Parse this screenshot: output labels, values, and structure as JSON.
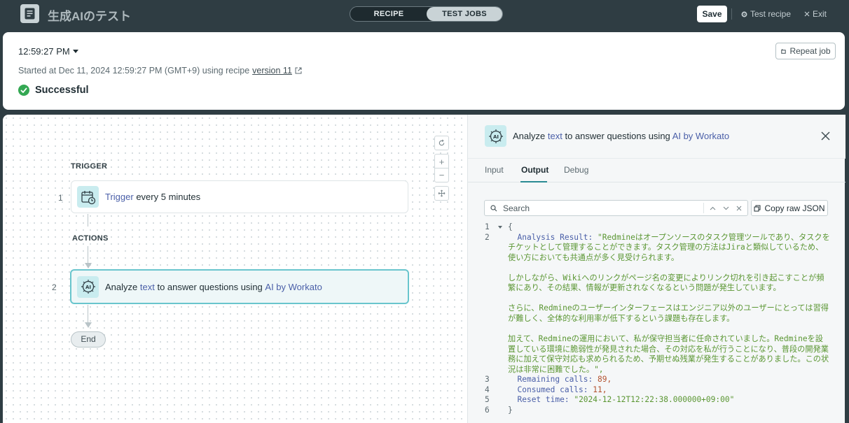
{
  "header": {
    "app_title": "生成AIのテスト",
    "mode_tabs": [
      "RECIPE",
      "TEST JOBS"
    ],
    "active_mode": "TEST JOBS",
    "save_label": "Save",
    "test_recipe_label": "Test recipe",
    "exit_label": "Exit"
  },
  "job": {
    "time": "12:59:27 PM",
    "started_text": "Started at Dec 11, 2024 12:59:27 PM (GMT+9) using recipe",
    "version_link": "version 11",
    "status": "Successful",
    "repeat_label": "Repeat job"
  },
  "canvas": {
    "trigger_label": "TRIGGER",
    "actions_label": "ACTIONS",
    "steps": [
      {
        "num": "1",
        "highlight": "Trigger",
        "text": "every 5 minutes"
      },
      {
        "num": "2",
        "pre": "Analyze",
        "highlight1": "text",
        "mid": "to answer questions using",
        "highlight2": "AI by Workato"
      }
    ],
    "end_label": "End"
  },
  "panel": {
    "title_pre": "Analyze",
    "title_hl1": "text",
    "title_mid": "to answer questions using",
    "title_hl2": "AI by Workato",
    "tabs": [
      "Input",
      "Output",
      "Debug"
    ],
    "active_tab": "Output",
    "search_placeholder": "Search",
    "copy_label": "Copy raw JSON",
    "code": {
      "open": "{",
      "analysis_key": "Analysis Result:",
      "analysis_value_p1": "\"Redmineはオープンソースのタスク管理ツールであり、タスクをチケットとして管理することができます。タスク管理の方法はJiraと類似しているため、使い方においても共通点が多く見受けられます。",
      "analysis_value_p2": "しかしながら、Wikiへのリンクがページ名の変更によりリンク切れを引き起こすことが頻繁にあり、その結果、情報が更新されなくなるという問題が発生しています。",
      "analysis_value_p3": "さらに、Redmineのユーザーインターフェースはエンジニア以外のユーザーにとっては習得が難しく、全体的な利用率が低下するという課題も存在します。",
      "analysis_value_p4": "加えて、Redmineの運用において、私が保守担当者に任命されていました。Redmineを設置している環境に脆弱性が発見された場合、その対応を私が行うことになり、普段の開発業務に加えて保守対応も求められるため、予期せぬ残業が発生することがありました。この状況は非常に困難でした。\",",
      "remaining_key": "Remaining calls:",
      "remaining_val": "89,",
      "consumed_key": "Consumed calls:",
      "consumed_val": "11,",
      "reset_key": "Reset time:",
      "reset_val": "\"2024-12-12T12:22:38.000000+09:00\"",
      "close": "}",
      "line_numbers": [
        "1",
        "2",
        "3",
        "4",
        "5",
        "6"
      ]
    }
  },
  "colors": {
    "topbar": "#2f3d43",
    "accent": "#69c5cd",
    "link": "#4a5fa8",
    "success": "#34a853",
    "string": "#5a9632",
    "number": "#b3522f"
  }
}
